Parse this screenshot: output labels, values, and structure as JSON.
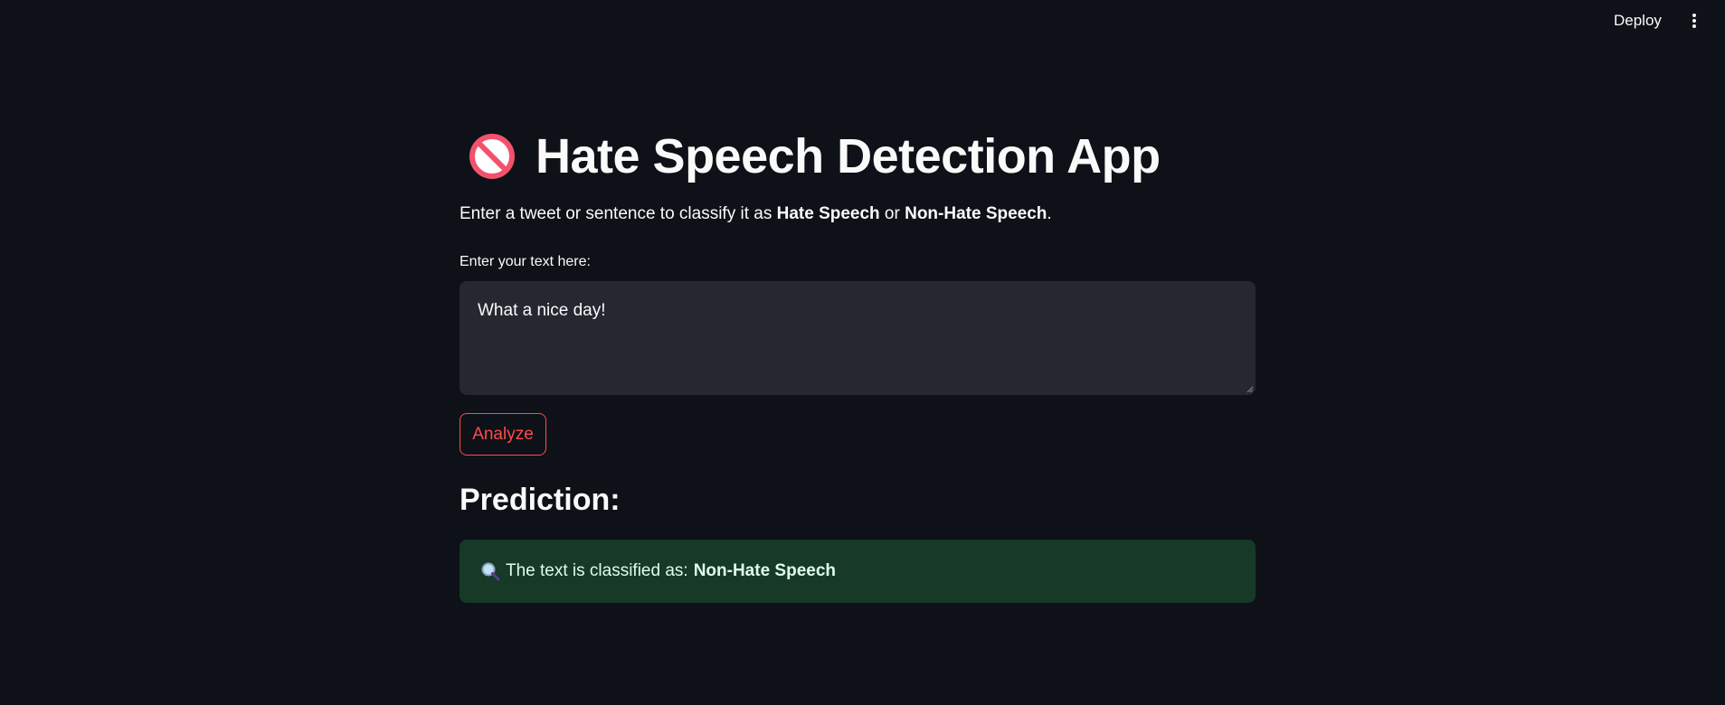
{
  "header": {
    "deploy_label": "Deploy",
    "menu_icon": "more-vertical-icon"
  },
  "app": {
    "title_icon": "prohibited-icon",
    "title": "Hate Speech Detection App",
    "description": {
      "prefix": "Enter a tweet or sentence to classify it as ",
      "bold1": "Hate Speech",
      "middle": " or ",
      "bold2": "Non-Hate Speech",
      "suffix": "."
    }
  },
  "input": {
    "label": "Enter your text here:",
    "value": "What a nice day!"
  },
  "actions": {
    "analyze_label": "Analyze"
  },
  "prediction": {
    "heading": "Prediction:",
    "icon": "magnifying-glass-icon",
    "prefix": "The text is classified as:",
    "value": "Non-Hate Speech"
  },
  "colors": {
    "background": "#0e1117",
    "input_bg": "#262730",
    "accent": "#ff4b4b",
    "success_bg": "#173928",
    "success_text": "#dffde9"
  }
}
